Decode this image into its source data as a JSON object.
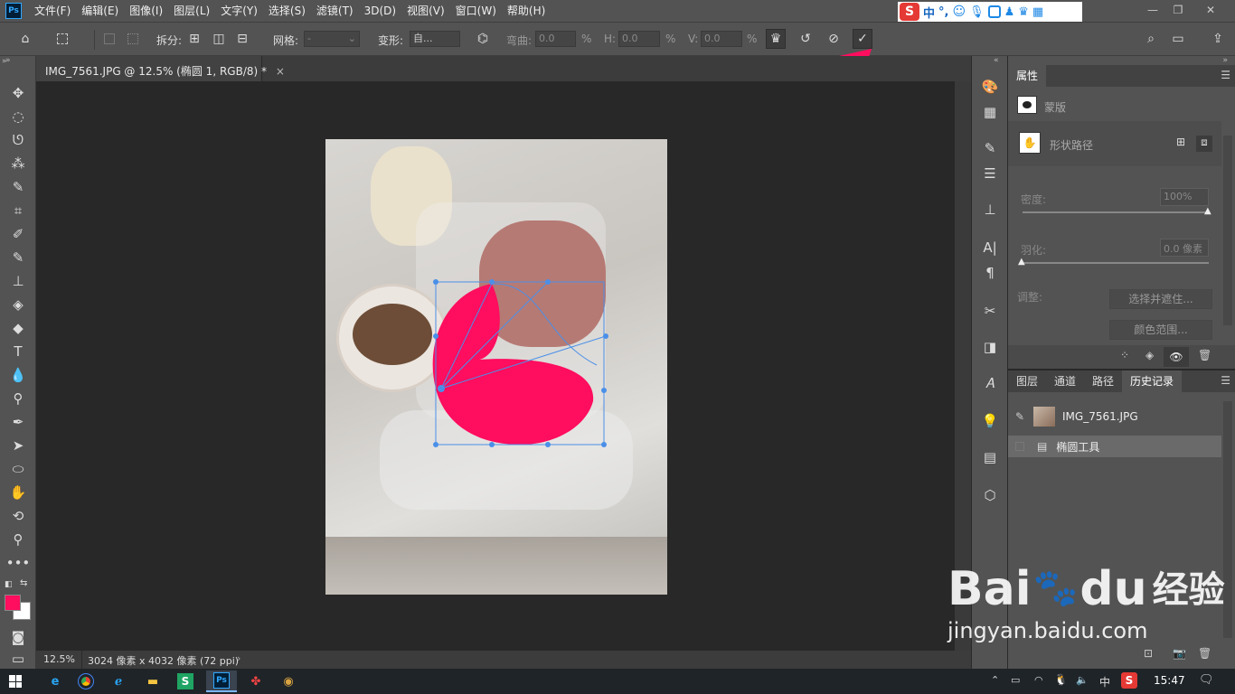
{
  "app": {
    "logo": "Ps",
    "menu": [
      "文件(F)",
      "编辑(E)",
      "图像(I)",
      "图层(L)",
      "文字(Y)",
      "选择(S)",
      "滤镜(T)",
      "3D(D)",
      "视图(V)",
      "窗口(W)",
      "帮助(H)"
    ],
    "ime": {
      "logo": "S",
      "mode": "中",
      "punct": "°,"
    },
    "window_controls": [
      "—",
      "❐",
      "✕"
    ]
  },
  "options": {
    "split_label": "拆分:",
    "grid_label": "网格:",
    "grid_value": "-",
    "warp_label": "变形:",
    "warp_value": "自...",
    "bend_label": "弯曲:",
    "bend_value": "0.0",
    "h_label": "H:",
    "h_value": "0.0",
    "v_label": "V:",
    "v_value": "0.0",
    "percent": "%"
  },
  "document": {
    "tab_title": "IMG_7561.JPG @ 12.5% (椭圆 1, RGB/8) *",
    "close": "×",
    "zoom": "12.5%",
    "dimensions": "3024 像素 x 4032 像素 (72 ppi)"
  },
  "properties": {
    "tab": "属性",
    "mask_label": "蒙版",
    "shape_path_label": "形状路径",
    "density_label": "密度:",
    "density_value": "100%",
    "density_level": 1.0,
    "feather_label": "羽化:",
    "feather_value": "0.0 像素",
    "feather_level": 0.0,
    "adjust_label": "调整:",
    "select_mask_button": "选择并遮住...",
    "color_range_button": "颜色范围..."
  },
  "history_panel": {
    "tabs": [
      "图层",
      "通道",
      "路径",
      "历史记录"
    ],
    "active_tab": 3,
    "snapshot": "IMG_7561.JPG",
    "steps": [
      "椭圆工具"
    ]
  },
  "taskbar": {
    "time": "15:47",
    "ime": "中"
  },
  "watermark": {
    "brand": "Bai",
    "brand2": "du",
    "jingyan": "经验",
    "url": "jingyan.baidu.com"
  },
  "colors": {
    "accent_pink": "#ff0d5f",
    "foreground": "#ff0d5f",
    "path": "#4a8fe8"
  }
}
